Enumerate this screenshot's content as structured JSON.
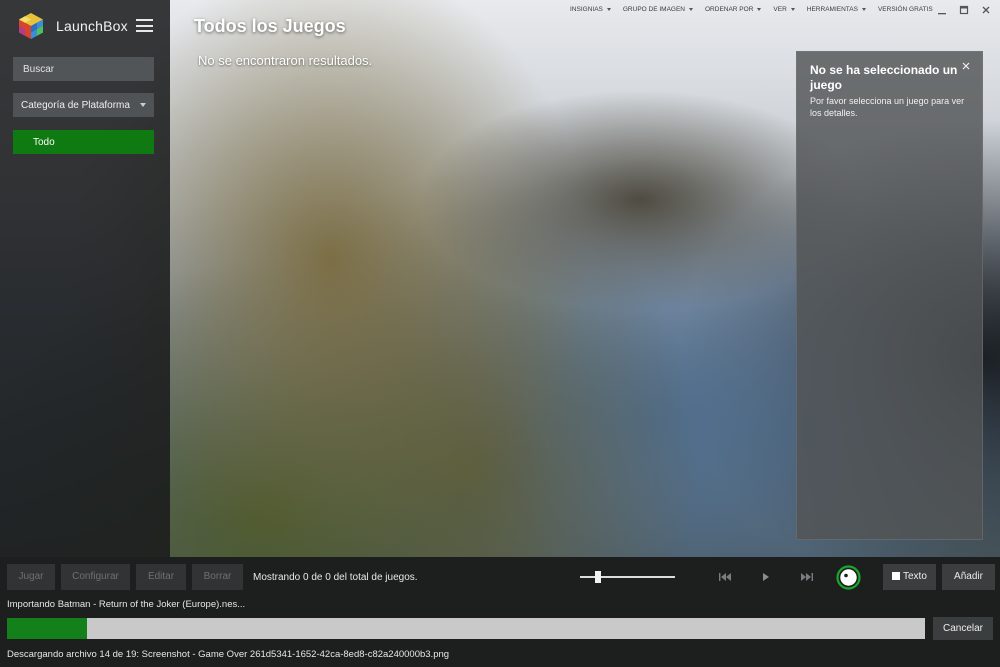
{
  "app": {
    "name": "LaunchBox"
  },
  "sidebar": {
    "search_placeholder": "Buscar",
    "platform_select": "Categoría de Plataforma",
    "filter_all": "Todo"
  },
  "main": {
    "title": "Todos los Juegos",
    "no_results": "No se encontraron resultados."
  },
  "top_menu": {
    "items": [
      "INSIGNIAS",
      "GRUPO DE IMAGEN",
      "ORDENAR POR",
      "VER",
      "HERRAMIENTAS",
      "VERSIÓN GRATIS"
    ]
  },
  "details_panel": {
    "title": "No se ha seleccionado un juego",
    "text": "Por favor selecciona un juego para ver los detalles."
  },
  "toolbar": {
    "play": "Jugar",
    "configure": "Configurar",
    "edit": "Editar",
    "delete": "Borrar",
    "showing": "Mostrando 0 de 0 del total de juegos.",
    "zoom_level": 0.17,
    "text_toggle": "Texto",
    "add": "Añadir"
  },
  "status": {
    "importing": "Importando Batman - Return of the Joker (Europe).nes...",
    "progress": 0.087,
    "cancel": "Cancelar",
    "downloading": "Descargando archivo 14 de 19: Screenshot - Game Over 261d5341-1652-42ca-8ed8-c82a240000b3.png"
  },
  "colors": {
    "accent_green": "#0f7a12",
    "progress_green": "#13801a"
  }
}
